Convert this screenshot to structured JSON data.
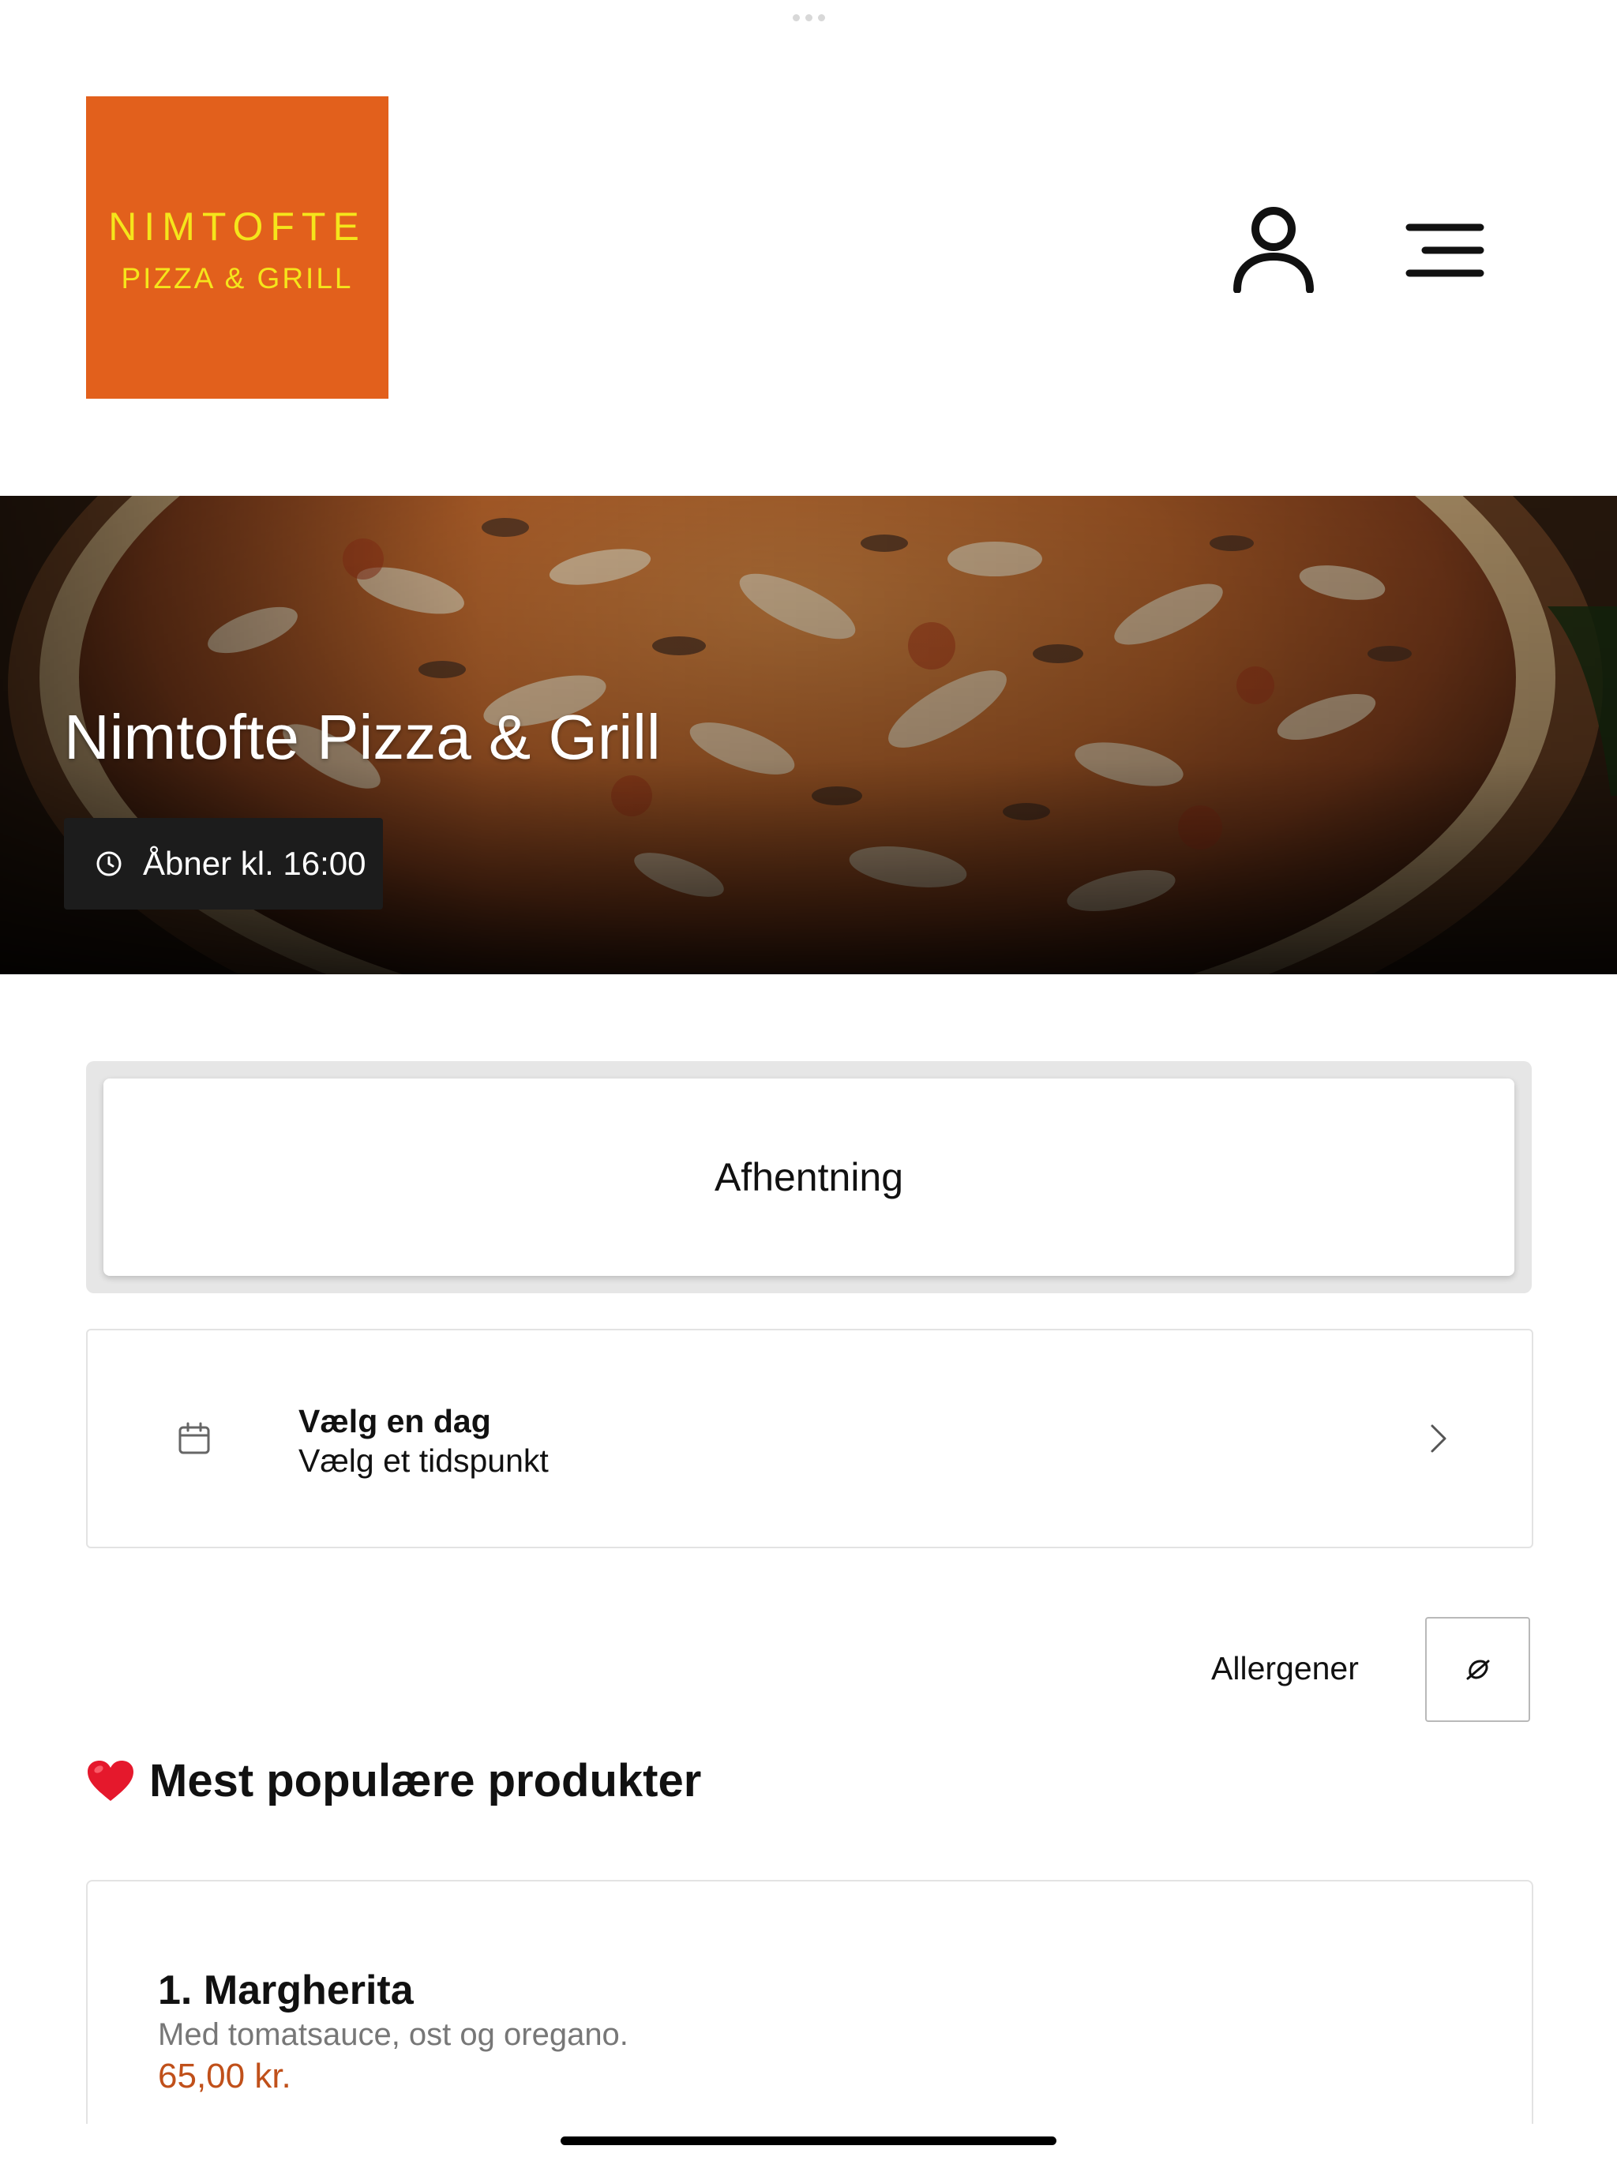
{
  "logo": {
    "line1": "NIMTOFTE",
    "line2": "PIZZA & GRILL",
    "bg_color": "#e2601c",
    "text_color": "#f5e51b"
  },
  "header": {
    "account_icon": "user-icon",
    "menu_icon": "hamburger-menu-icon"
  },
  "hero": {
    "title": "Nimtofte Pizza & Grill",
    "hours": "Åbner kl. 16:00"
  },
  "order_mode": {
    "selected": "Afhentning"
  },
  "schedule": {
    "day_label": "Vælg en dag",
    "time_label": "Vælg et tidspunkt"
  },
  "allergens": {
    "label": "Allergener",
    "icon": "allergen-icon"
  },
  "popular": {
    "title": "Mest populære produkter",
    "emoji": "❤️",
    "products": [
      {
        "name": "1. Margherita",
        "description": "Med tomatsauce, ost og oregano.",
        "price": "65,00 kr."
      }
    ]
  },
  "colors": {
    "accent": "#c0501a",
    "card_border": "#e3e3e3"
  }
}
